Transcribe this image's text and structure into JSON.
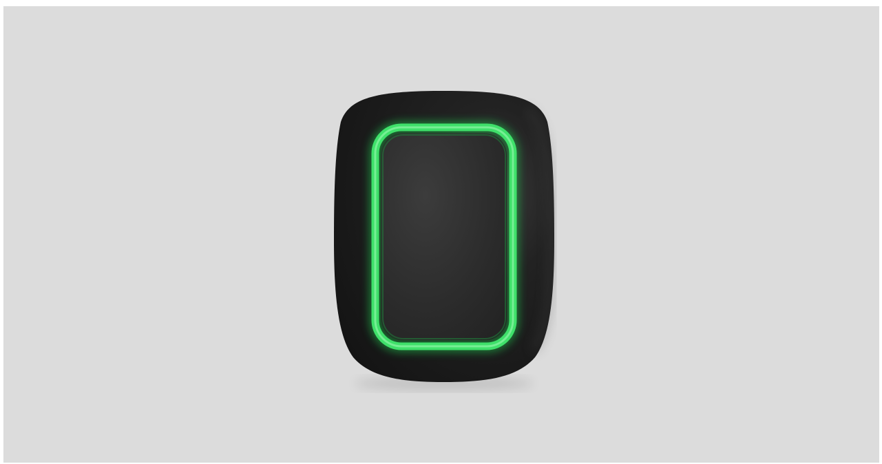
{
  "scene": {
    "subject": "panic-button-device",
    "colors": {
      "background": "#dcdcdc",
      "body": "#1b1b1b",
      "body_highlight": "#3a3a3a",
      "button_face": "#2e2e2e",
      "led_ring": "#3fe06a",
      "led_glow": "#1fc24b"
    }
  }
}
